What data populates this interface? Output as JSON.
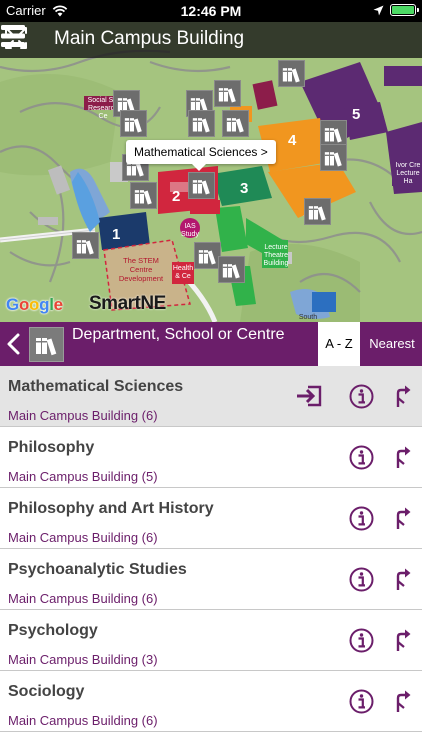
{
  "status_bar": {
    "carrier": "Carrier",
    "time": "12:46 PM",
    "battery_level": 1.0
  },
  "map": {
    "title": "Main Campus Building",
    "callout": "Mathematical Sciences >",
    "zones": [
      "1",
      "2",
      "3",
      "4",
      "5"
    ],
    "building_labels": {
      "stem": "The STEM Centre Development",
      "social": "Social Sci Research Ce",
      "lecture": "Lecture Theatre Building",
      "ivor": "Ivor Cre Lecture Ha",
      "health": "Health & Ce",
      "ias": "IAS Study",
      "south": "South"
    },
    "google_logo": "Google",
    "smartne_logo": "SmartNE",
    "colors": {
      "grass": "#a3c27c",
      "zone1": "#1b3a6b",
      "zone2": "#d1263e",
      "zone3": "#1f8a56",
      "zone4": "#f1961f",
      "zone5": "#5c2a72",
      "accent": "#6b1e6a"
    }
  },
  "filter_bar": {
    "label": "Department, School or Centre",
    "back_icon": "chevron-left-icon",
    "az_label": "A - Z",
    "nearest_label": "Nearest"
  },
  "departments": [
    {
      "name": "Mathematical Sciences",
      "location": "Main Campus Building (6)",
      "selected": true
    },
    {
      "name": "Philosophy",
      "location": "Main Campus Building (5)",
      "selected": false
    },
    {
      "name": "Philosophy and Art History",
      "location": "Main Campus Building (6)",
      "selected": false
    },
    {
      "name": "Psychoanalytic Studies",
      "location": "Main Campus Building (6)",
      "selected": false
    },
    {
      "name": "Psychology",
      "location": "Main Campus Building (3)",
      "selected": false
    },
    {
      "name": "Sociology",
      "location": "Main Campus Building (6)",
      "selected": false
    }
  ]
}
